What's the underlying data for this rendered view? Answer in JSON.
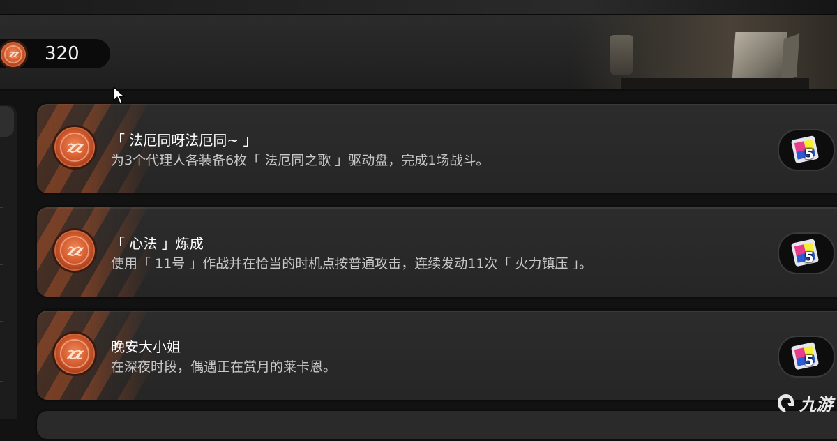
{
  "header": {
    "currency": {
      "icon": "coin-icon",
      "value": "320"
    }
  },
  "achievements": [
    {
      "title": "「 法厄同呀法厄同~ 」",
      "description": "为3个代理人各装备6枚「 法厄同之歌 」驱动盘，完成1场战斗。",
      "icon": "coin-icon",
      "reward": {
        "icon": "film-reward-icon",
        "count": "5"
      }
    },
    {
      "title": "「 心法 」炼成",
      "description": "使用「 11号 」作战并在恰当的时机点按普通攻击，连续发动11次「 火力镇压 」。",
      "icon": "coin-icon",
      "reward": {
        "icon": "film-reward-icon",
        "count": "5"
      }
    },
    {
      "title": "晚安大小姐",
      "description": "在深夜时段，偶遇正在赏月的莱卡恩。",
      "icon": "coin-icon",
      "reward": {
        "icon": "film-reward-icon",
        "count": "5"
      }
    }
  ],
  "watermark": {
    "text": "九游"
  },
  "colors": {
    "coin": "#d35a2d",
    "accent": "#c85a28",
    "card": "#2a2a2a"
  }
}
